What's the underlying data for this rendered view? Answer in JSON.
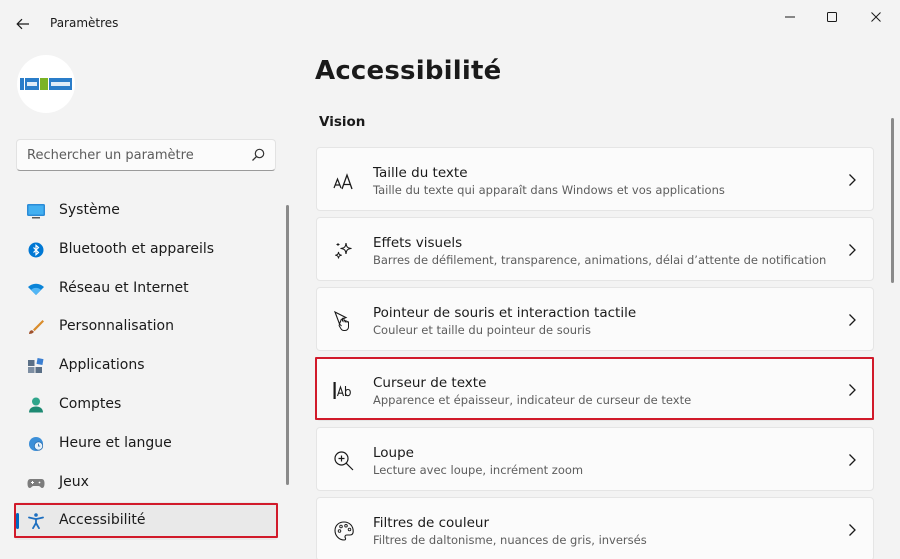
{
  "window": {
    "title": "Paramètres",
    "controls": [
      "minimize-icon",
      "maximize-icon",
      "close-icon"
    ]
  },
  "avatar": {
    "logo_text": "info-4-android",
    "colors": {
      "blue": "#2a7dc9",
      "green": "#7bb324"
    }
  },
  "search": {
    "placeholder": "Rechercher un paramètre",
    "icon": "search-icon"
  },
  "sidebar": {
    "items": [
      {
        "label": "Système",
        "icon": "system-monitor-icon",
        "selected": false
      },
      {
        "label": "Bluetooth et appareils",
        "icon": "bluetooth-icon",
        "selected": false
      },
      {
        "label": "Réseau et Internet",
        "icon": "wifi-icon",
        "selected": false
      },
      {
        "label": "Personnalisation",
        "icon": "brush-icon",
        "selected": false
      },
      {
        "label": "Applications",
        "icon": "apps-icon",
        "selected": false
      },
      {
        "label": "Comptes",
        "icon": "account-icon",
        "selected": false
      },
      {
        "label": "Heure et langue",
        "icon": "clock-globe-icon",
        "selected": false
      },
      {
        "label": "Jeux",
        "icon": "gamepad-icon",
        "selected": false
      },
      {
        "label": "Accessibilité",
        "icon": "accessibility-icon",
        "selected": true
      }
    ]
  },
  "main": {
    "title": "Accessibilité",
    "section": "Vision",
    "cards": [
      {
        "title": "Taille du texte",
        "subtitle": "Taille du texte qui apparaît dans Windows et vos applications",
        "icon": "text-size-icon"
      },
      {
        "title": "Effets visuels",
        "subtitle": "Barres de défilement, transparence, animations, délai d’attente de notification",
        "icon": "sparkle-icon"
      },
      {
        "title": "Pointeur de souris et interaction tactile",
        "subtitle": "Couleur et taille du pointeur de souris",
        "icon": "touch-pointer-icon"
      },
      {
        "title": "Curseur de texte",
        "subtitle": "Apparence et épaisseur, indicateur de curseur de texte",
        "icon": "text-cursor-icon"
      },
      {
        "title": "Loupe",
        "subtitle": "Lecture avec loupe, incrément zoom",
        "icon": "magnifier-icon"
      },
      {
        "title": "Filtres de couleur",
        "subtitle": "Filtres de daltonisme, nuances de gris, inversés",
        "icon": "color-palette-icon"
      }
    ]
  },
  "colors": {
    "accent": "#0067c0",
    "highlight_outline": "#d11a2a",
    "background": "#f3f3f3"
  }
}
